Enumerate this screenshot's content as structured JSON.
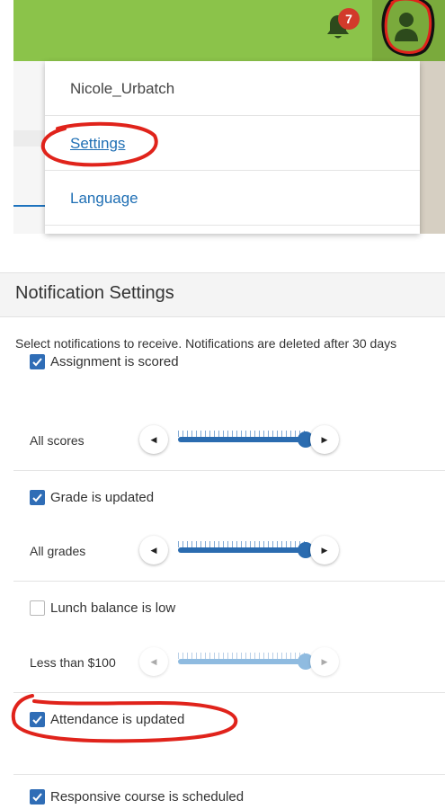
{
  "header": {
    "notification_count": "7",
    "bell_icon": "bell-icon",
    "user_icon": "user-icon"
  },
  "user_menu": {
    "username": "Nicole_Urbatch",
    "settings_label": "Settings",
    "language_label": "Language"
  },
  "notification_settings": {
    "title": "Notification Settings",
    "description": "Select notifications to receive. Notifications are deleted after 30 days",
    "items": [
      {
        "label": "Assignment is scored",
        "checked": true,
        "level_label": "All scores",
        "level": 1.0,
        "enabled": true
      },
      {
        "label": "Grade is updated",
        "checked": true,
        "level_label": "All grades",
        "level": 1.0,
        "enabled": true
      },
      {
        "label": "Lunch balance is low",
        "checked": false,
        "level_label": "Less than $100",
        "level": 1.0,
        "enabled": false
      },
      {
        "label": "Attendance is updated",
        "checked": true
      },
      {
        "label": "Responsive course is scheduled",
        "checked": true
      }
    ]
  },
  "colors": {
    "header_green": "#8bc34a",
    "link_blue": "#1f6fb4",
    "checkbox_blue": "#2f6db6",
    "badge_red": "#d23a2b",
    "annotation_red": "#e0231b"
  }
}
